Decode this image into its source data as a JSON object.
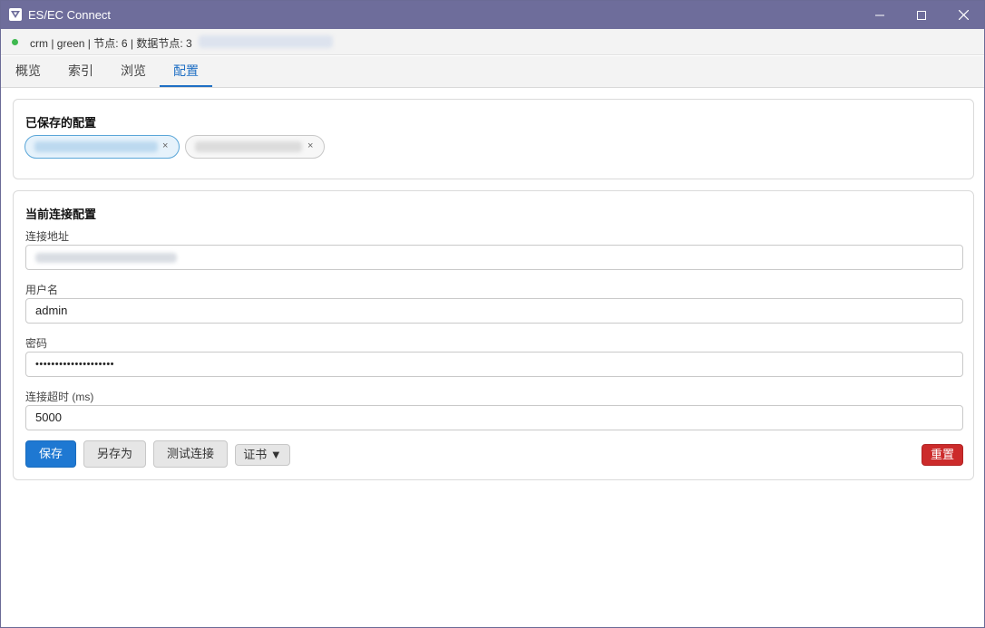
{
  "window": {
    "title": "ES/EC Connect"
  },
  "status": {
    "text": "crm | green | 节点: 6 | 数据节点: 3",
    "health_color": "#3fb950"
  },
  "tabs": [
    {
      "label": "概览"
    },
    {
      "label": "索引"
    },
    {
      "label": "浏览"
    },
    {
      "label": "配置",
      "active": true
    }
  ],
  "saved": {
    "title": "已保存的配置",
    "chips": [
      {
        "close": "×",
        "active": true
      },
      {
        "close": "×",
        "active": false
      }
    ]
  },
  "current": {
    "title": "当前连接配置",
    "fields": {
      "url_label": "连接地址",
      "username_label": "用户名",
      "username_value": "admin",
      "password_label": "密码",
      "password_value": "••••••••••••••••••••",
      "timeout_label": "连接超时 (ms)",
      "timeout_value": "5000"
    },
    "buttons": {
      "save": "保存",
      "save_as": "另存为",
      "test": "测试连接",
      "cert": "证书 ▼",
      "reset": "重置"
    }
  },
  "colors": {
    "titlebar": "#6e6d9b",
    "accent": "#1e78d2",
    "danger": "#cc2b2b"
  }
}
